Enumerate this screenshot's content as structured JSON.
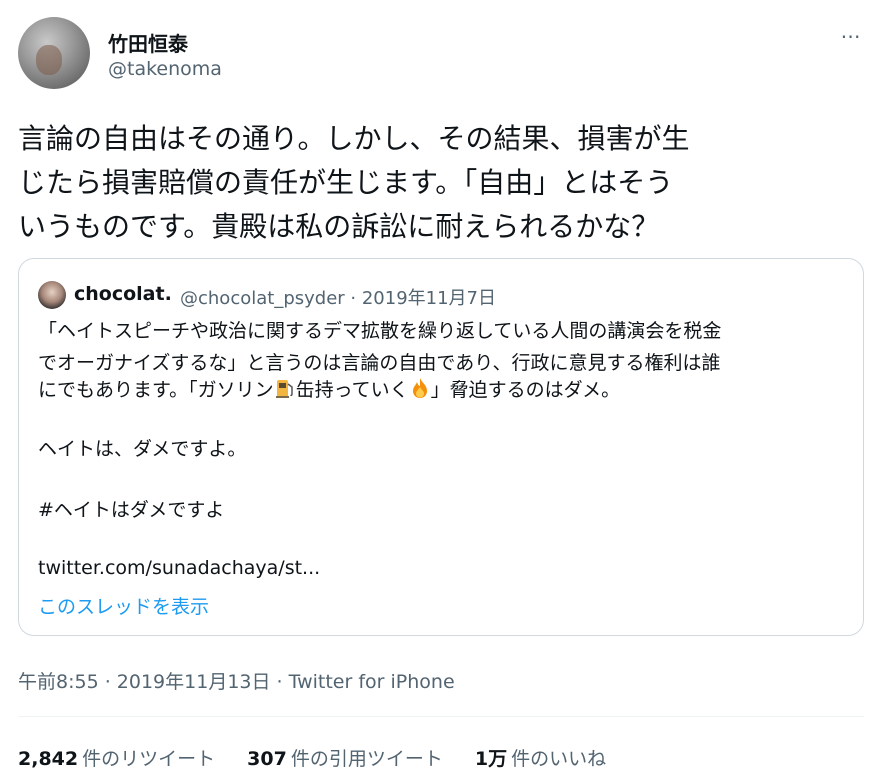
{
  "author": {
    "display_name": "竹田恒泰",
    "handle": "@takenoma"
  },
  "more_icon": "⋯",
  "tweet": {
    "lines": [
      "言論の自由はその通り。しかし、その結果、損害が生",
      "じたら損害賠償の責任が生じます。「自由」とはそう",
      "いうものです。貴殿は私の訴訟に耐えられるかな？"
    ]
  },
  "quoted": {
    "display_name": "chocolat.",
    "meta": "@chocolat_psyder · 2019年11月7日",
    "lines": {
      "l1": "「ヘイトスピーチや政治に関するデマ拡散を繰り返している人間の講演会を税金",
      "l2": "でオーガナイズするな」と言うのは言論の自由であり、行政に意見する権利は誰",
      "l3a": "にでもあります。「ガソリン",
      "l3b": "缶持っていく",
      "l3c": "」脅迫するのはダメ。",
      "l4": "ヘイトは、ダメですよ。",
      "l5": "#ヘイトはダメですよ"
    },
    "emoji_icons": [
      "fuel-pump-icon",
      "fire-icon"
    ],
    "link": "twitter.com/sunadachaya/st...",
    "show_thread": "このスレッドを表示"
  },
  "timestamp": "午前8:55 · 2019年11月13日 · Twitter for iPhone",
  "stats": {
    "retweets_count": "2,842",
    "retweets_label": "件のリツイート",
    "quotes_count": "307",
    "quotes_label": "件の引用ツイート",
    "likes_count": "1万",
    "likes_label": "件のいいね"
  },
  "colors": {
    "text": "#0f1419",
    "secondary": "#536471",
    "link": "#1d9bf0",
    "border": "#cfd9de"
  }
}
